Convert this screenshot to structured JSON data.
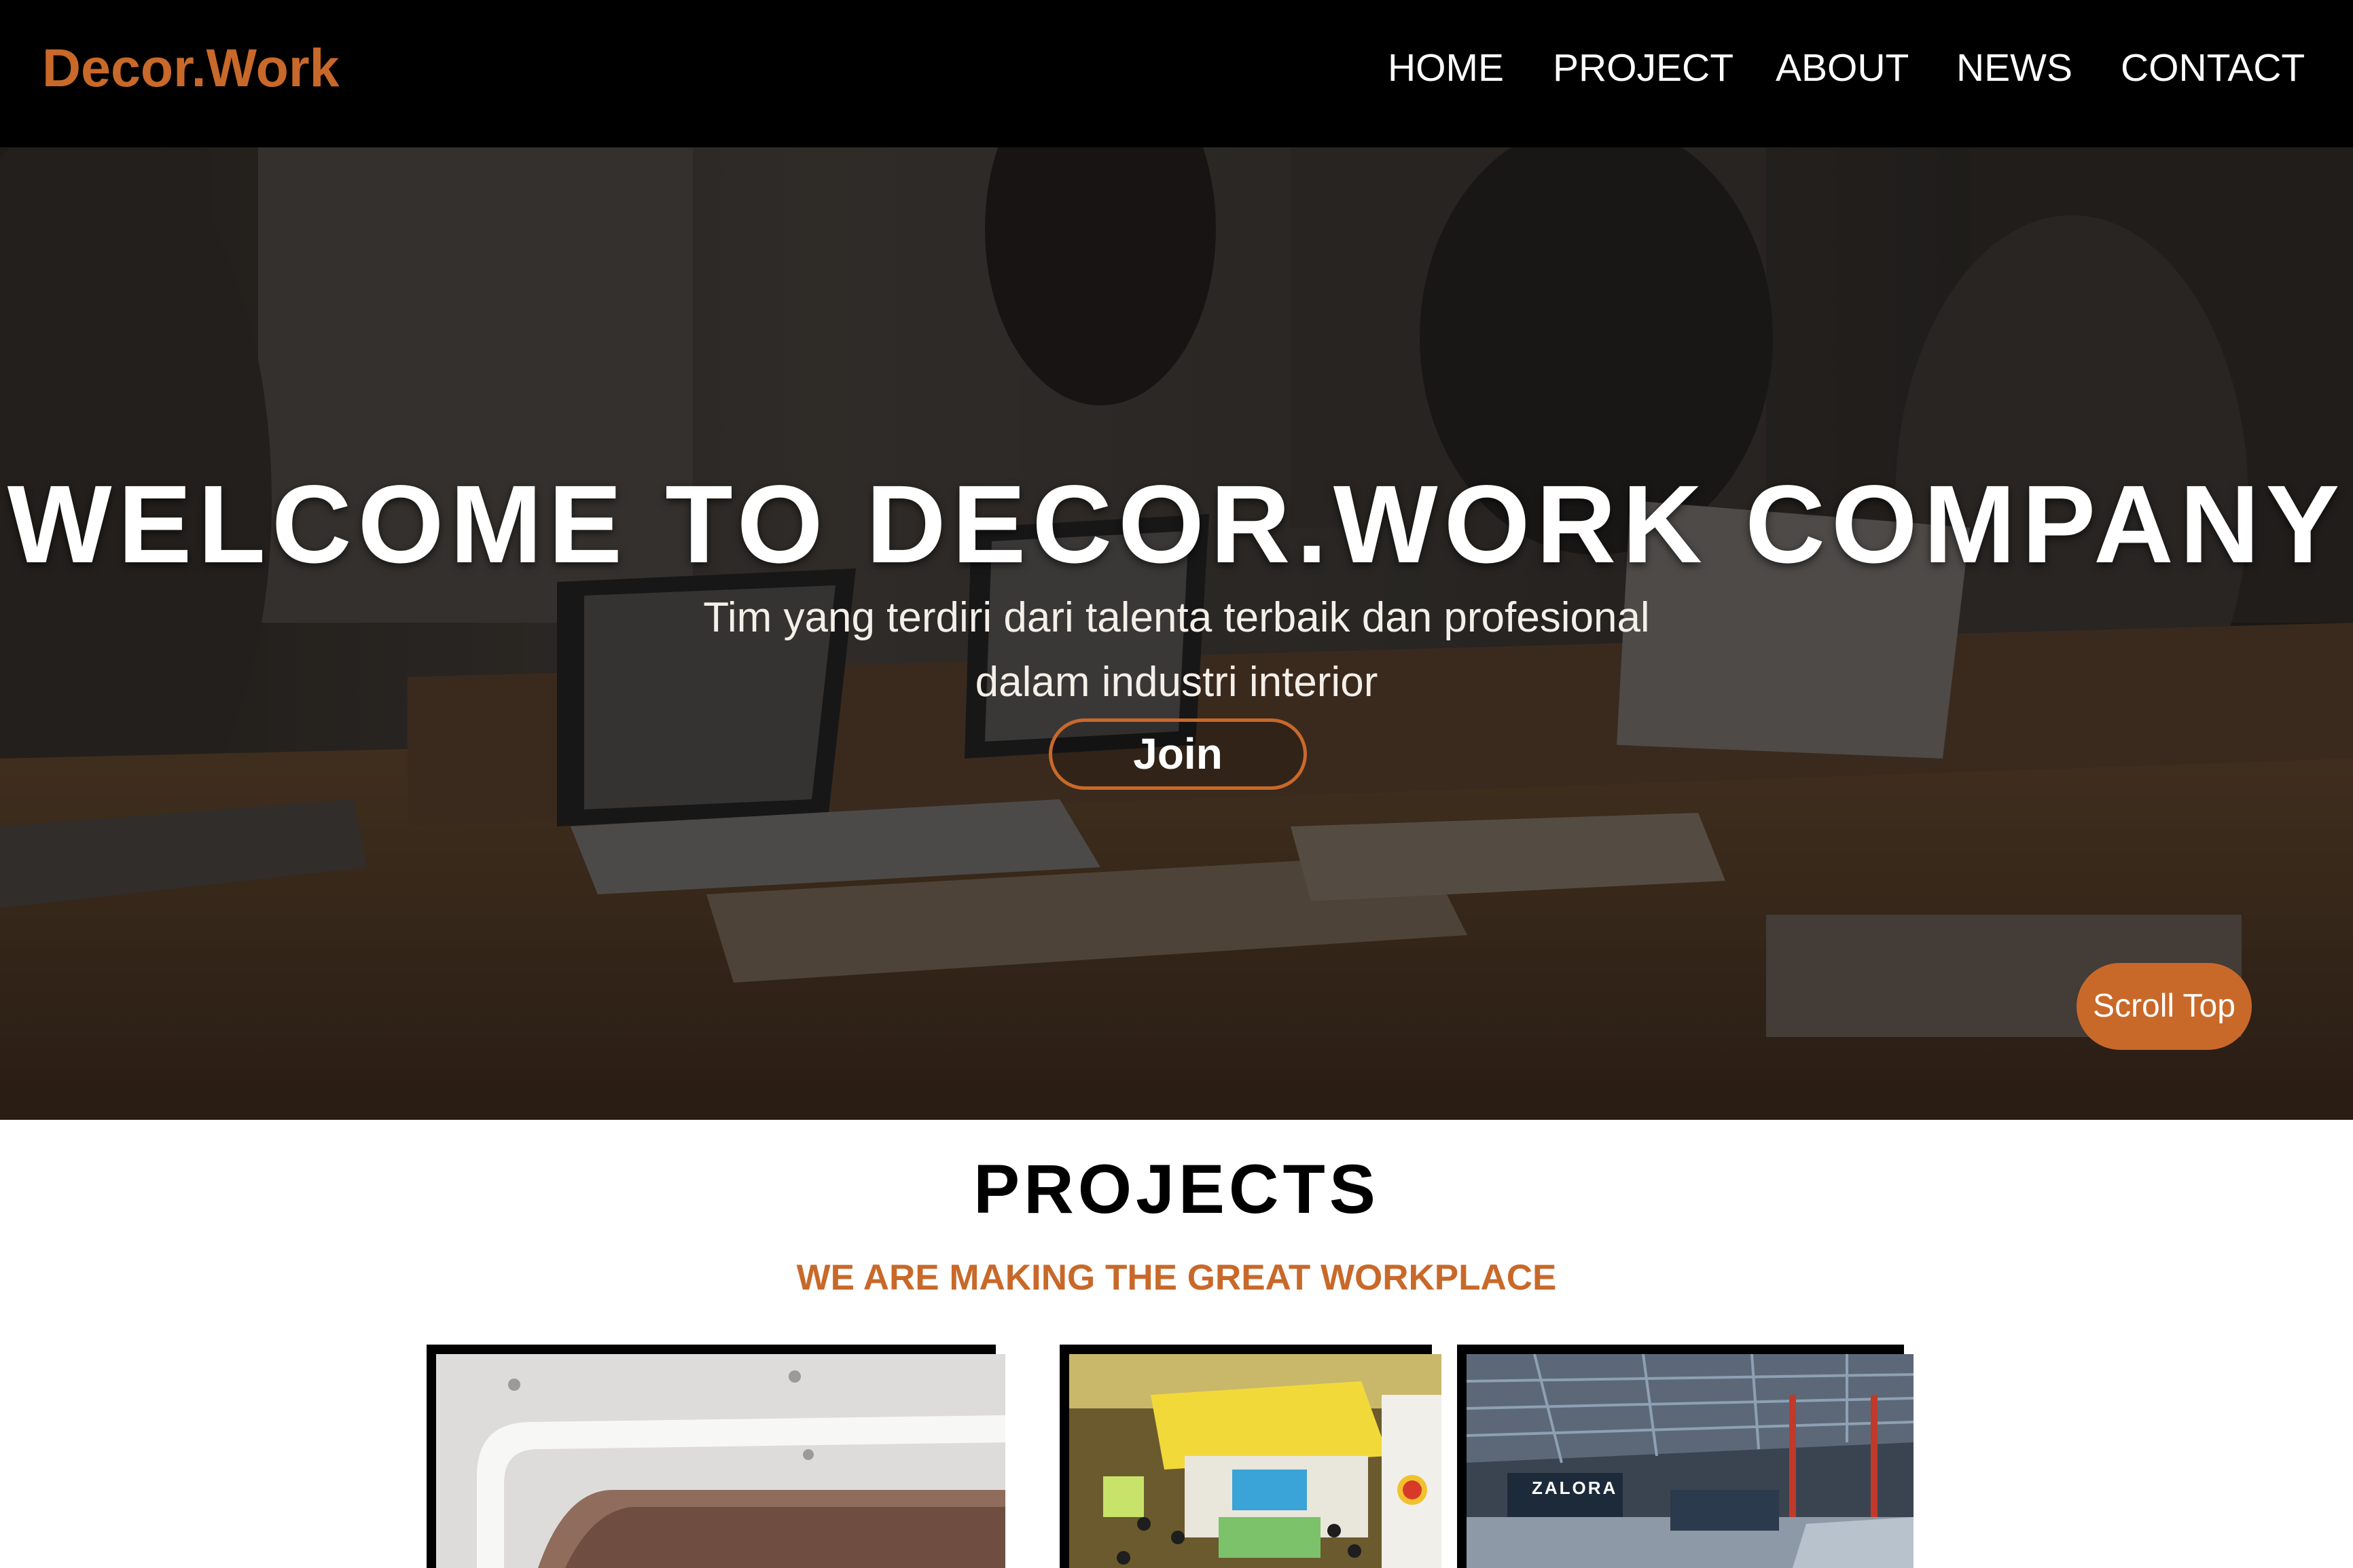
{
  "navbar": {
    "brand": "Decor.Work",
    "items": [
      "HOME",
      "PROJECT",
      "ABOUT",
      "NEWS",
      "CONTACT"
    ]
  },
  "hero": {
    "title": "WELCOME TO DECOR.WORK COMPANY",
    "subtitle_line1": "Tim yang terdiri dari talenta terbaik dan profesional",
    "subtitle_line2": "dalam industri interior",
    "join_label": "Join",
    "scroll_top_label": "Scroll Top"
  },
  "projects": {
    "title": "PROJECTS",
    "subtitle": "WE ARE MAKING THE GREAT WORKPLACE",
    "cards": [
      {
        "logo_text": ""
      },
      {
        "logo_text": ""
      },
      {
        "logo_text": "ZALORA"
      }
    ]
  },
  "colors": {
    "accent": "#c8692a",
    "navbar_bg": "#000000",
    "text_light": "#ffffff"
  }
}
